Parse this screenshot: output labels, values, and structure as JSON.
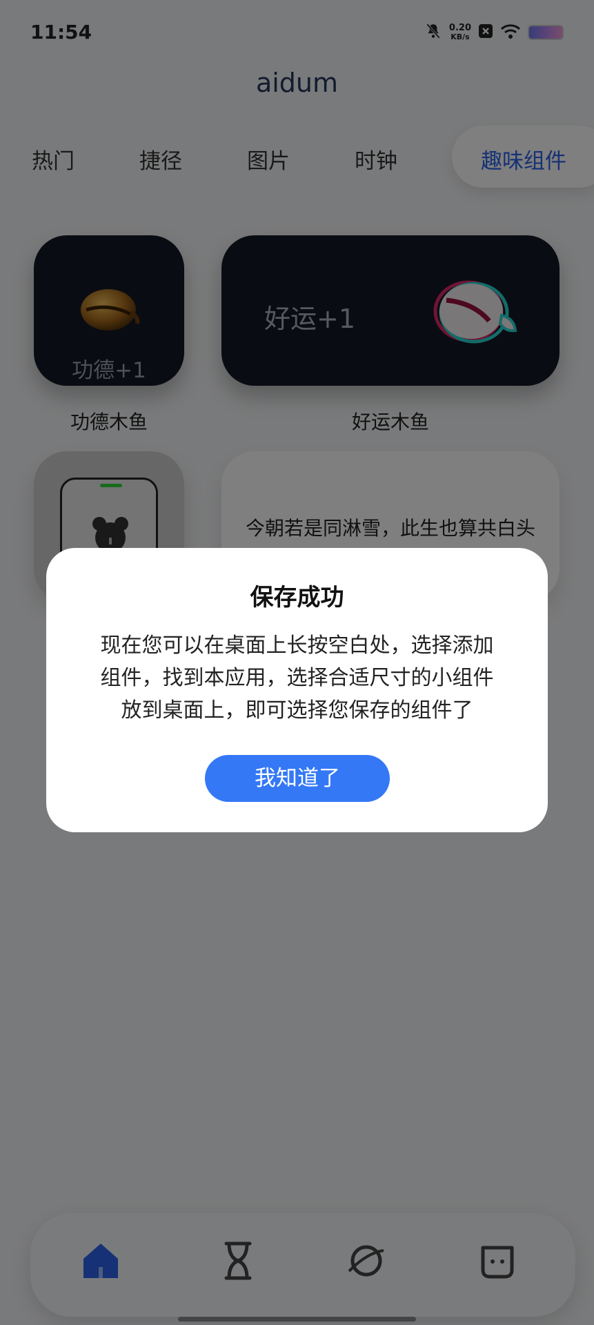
{
  "status_bar": {
    "time": "11:54",
    "net_speed_value": "0.20",
    "net_speed_unit": "KB/s",
    "icons": [
      "bell-muted-icon",
      "close-box-icon",
      "wifi-icon",
      "battery-icon"
    ]
  },
  "header": {
    "title": "aidum"
  },
  "tabs": [
    {
      "label": "热门"
    },
    {
      "label": "捷径"
    },
    {
      "label": "图片"
    },
    {
      "label": "时钟"
    },
    {
      "label": "趣味组件",
      "active": true
    }
  ],
  "widgets": {
    "merit_fish": {
      "text": "功德+1",
      "caption": "功德木鱼"
    },
    "luck_fish": {
      "text": "好运+1",
      "caption": "好运木鱼"
    },
    "poem": {
      "text": "今朝若是同淋雪，此生也算共白头"
    }
  },
  "bottom_nav": {
    "items": [
      {
        "icon": "home-icon"
      },
      {
        "icon": "hourglass-icon"
      },
      {
        "icon": "planet-icon"
      },
      {
        "icon": "chat-face-icon"
      }
    ]
  },
  "dialog": {
    "title": "保存成功",
    "body_lines": [
      "现在您可以在桌面上长按空白处，选择添加",
      "组件，找到本应用，选择合适尺寸的小组件",
      "放到桌面上，即可选择您保存的组件了"
    ],
    "button": "我知道了"
  },
  "colors": {
    "accent": "#3478f6",
    "active_tab": "#2d63ea",
    "widget_dark": "#151826",
    "overlay": "rgba(0,0,0,0.5)"
  }
}
